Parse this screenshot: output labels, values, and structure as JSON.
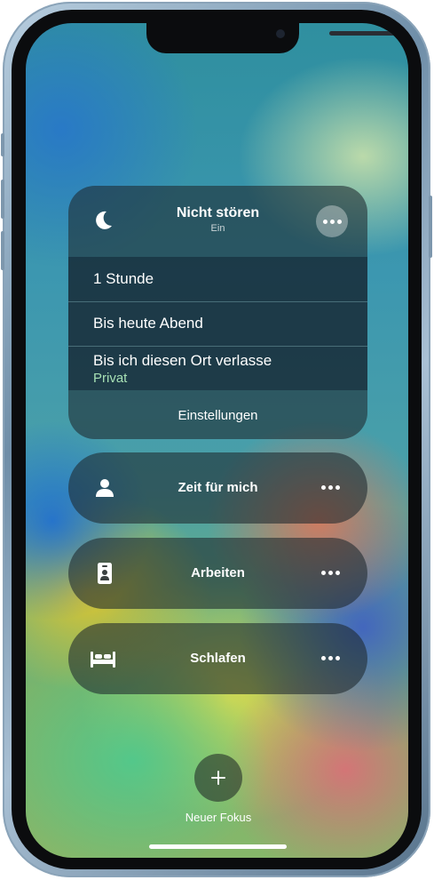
{
  "dnd": {
    "title": "Nicht stören",
    "status": "Ein",
    "options": {
      "one_hour": "1 Stunde",
      "until_evening": "Bis heute Abend",
      "until_leave": "Bis ich diesen Ort verlasse",
      "location": "Privat"
    },
    "settings": "Einstellungen"
  },
  "focus_modes": {
    "personal": "Zeit für mich",
    "work": "Arbeiten",
    "sleep": "Schlafen"
  },
  "new_focus": {
    "label": "Neuer Fokus"
  },
  "colors": {
    "accent_location": "#a7e0b4",
    "card_background": "rgba(30,40,45,0.58)"
  },
  "icons": {
    "dnd": "moon-icon",
    "personal": "person-icon",
    "work": "id-badge-icon",
    "sleep": "bed-icon",
    "more": "more-dots-icon",
    "add": "plus-icon"
  }
}
